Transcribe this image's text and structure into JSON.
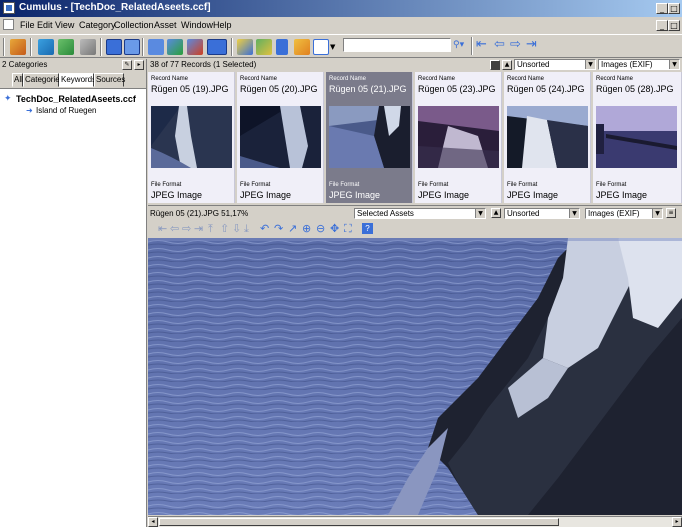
{
  "window": {
    "title": "Cumulus - [TechDoc_RelatedAseets.ccf]"
  },
  "menu": [
    "File",
    "Edit",
    "View",
    "Category",
    "Collection",
    "Asset",
    "Window",
    "Help"
  ],
  "toolbar": {
    "search_value": ""
  },
  "left_panel": {
    "category_count": "2 Categories",
    "tabs": [
      "All",
      "Categories",
      "Keywords",
      "Sources"
    ],
    "active_tab": "Keywords",
    "tree": [
      {
        "label": "TechDoc_RelatedAseets.ccf",
        "level": 0
      },
      {
        "label": "Island of Ruegen",
        "level": 1
      }
    ]
  },
  "gallery": {
    "record_count": "38 of 77 Records (1 Selected)",
    "sort": "Unsorted",
    "view": "Images (EXIF)",
    "field_label_name": "Record Name",
    "field_label_format": "File Format",
    "records": [
      {
        "name": "Rügen 05 (19).JPG",
        "format": "JPEG Image",
        "selected": false
      },
      {
        "name": "Rügen 05 (20).JPG",
        "format": "JPEG Image",
        "selected": false
      },
      {
        "name": "Rügen 05 (21).JPG",
        "format": "JPEG Image",
        "selected": true
      },
      {
        "name": "Rügen 05 (23).JPG",
        "format": "JPEG Image",
        "selected": false
      },
      {
        "name": "Rügen 05 (24).JPG",
        "format": "JPEG Image",
        "selected": false
      },
      {
        "name": "Rügen 05 (28).JPG",
        "format": "JPEG Image",
        "selected": false
      }
    ]
  },
  "preview": {
    "info": "Rügen 05 (21).JPG 51,17%",
    "scope": "Selected Assets",
    "sort": "Unsorted",
    "view": "Images (EXIF)"
  },
  "colors": {
    "titlebar_start": "#0a246a",
    "titlebar_end": "#a6caf0",
    "selected_card": "#7b7b8b",
    "card_bg": "#f0eff8",
    "nav_blue": "#3a6fd8"
  }
}
